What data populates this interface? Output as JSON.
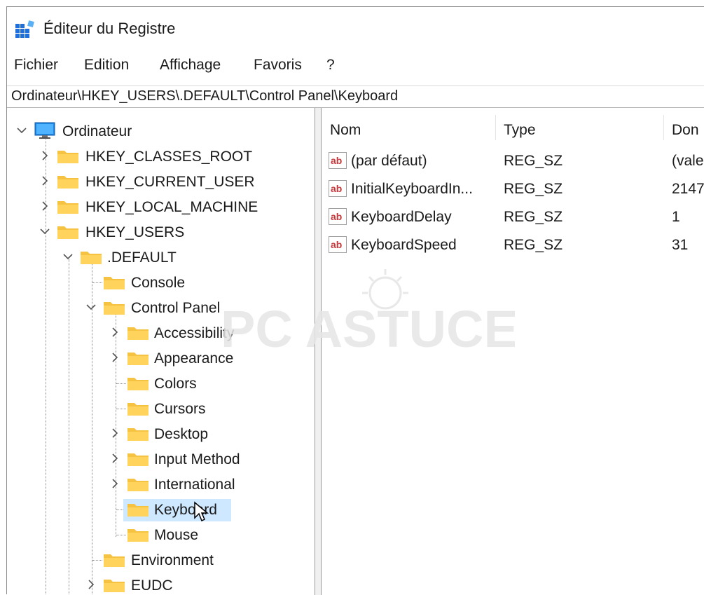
{
  "window": {
    "title": "Éditeur du Registre",
    "icon": "registry-editor-icon"
  },
  "menu": [
    {
      "label": "Fichier"
    },
    {
      "label": "Edition"
    },
    {
      "label": "Affichage"
    },
    {
      "label": "Favoris"
    },
    {
      "label": "?"
    }
  ],
  "address": {
    "path": "Ordinateur\\HKEY_USERS\\.DEFAULT\\Control Panel\\Keyboard"
  },
  "tree": {
    "root": "Ordinateur",
    "hives": [
      "HKEY_CLASSES_ROOT",
      "HKEY_CURRENT_USER",
      "HKEY_LOCAL_MACHINE",
      "HKEY_USERS"
    ],
    "default": ".DEFAULT",
    "default_children": [
      "Console",
      "Control Panel"
    ],
    "control_panel_children": [
      "Accessibility",
      "Appearance",
      "Colors",
      "Cursors",
      "Desktop",
      "Input Method",
      "International",
      "Keyboard",
      "Mouse"
    ],
    "after": [
      "Environment",
      "EUDC"
    ],
    "selected": "Keyboard"
  },
  "list": {
    "columns": [
      "Nom",
      "Type",
      "Don"
    ],
    "rows": [
      {
        "name": "(par défaut)",
        "type": "REG_SZ",
        "data": "(vale"
      },
      {
        "name": "InitialKeyboardIn...",
        "type": "REG_SZ",
        "data": "2147"
      },
      {
        "name": "KeyboardDelay",
        "type": "REG_SZ",
        "data": "1"
      },
      {
        "name": "KeyboardSpeed",
        "type": "REG_SZ",
        "data": "31"
      }
    ]
  },
  "watermark": {
    "text": "PC ASTUCES"
  },
  "colors": {
    "folder": "#f5c242",
    "selection": "#cde8ff",
    "ab_icon": "#c8393b"
  }
}
